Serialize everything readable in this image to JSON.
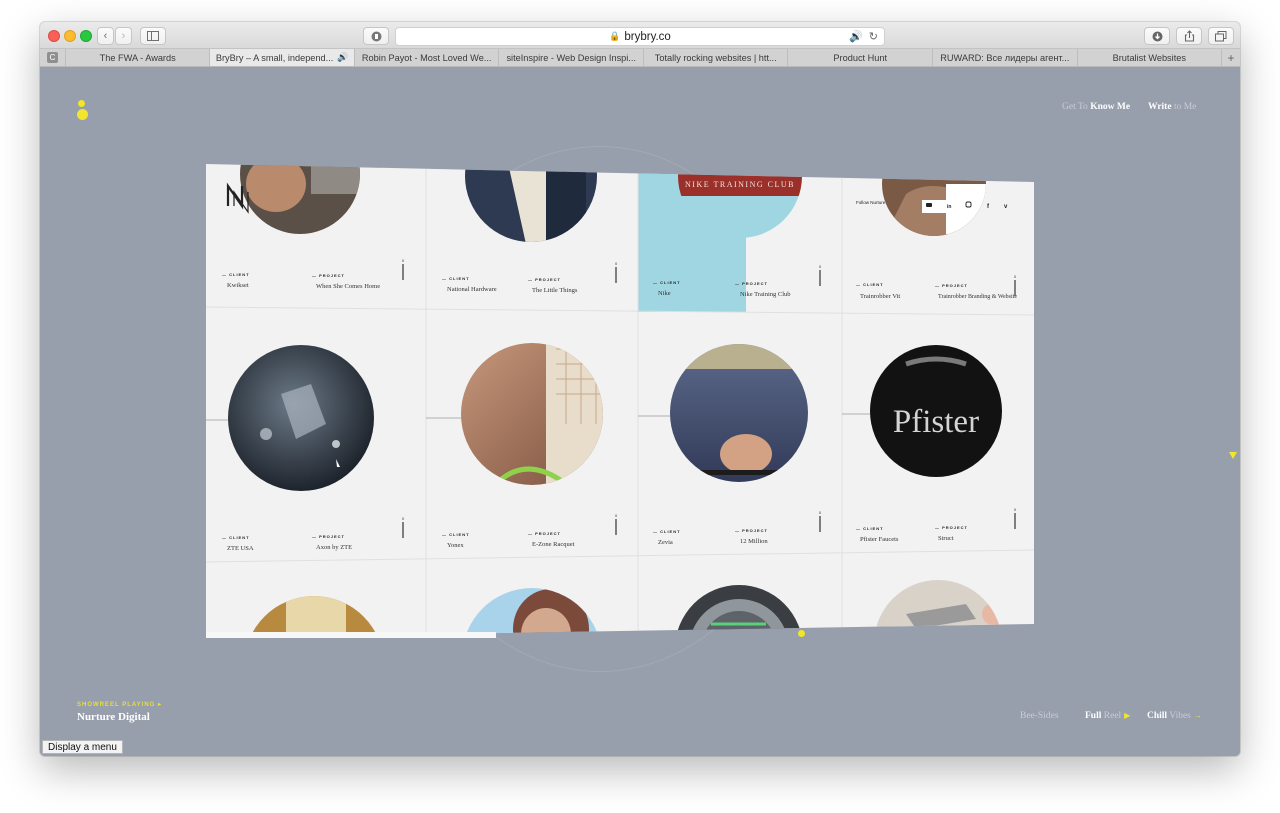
{
  "browser": {
    "url": "brybry.co",
    "tabs": [
      {
        "label": "The FWA - Awards",
        "active": false,
        "audio": false
      },
      {
        "label": "BryBry – A small, independ...",
        "active": true,
        "audio": true
      },
      {
        "label": "Robin Payot - Most Loved We...",
        "active": false,
        "audio": false
      },
      {
        "label": "siteInspire - Web Design Inspi...",
        "active": false,
        "audio": false
      },
      {
        "label": "Totally rocking websites | htt...",
        "active": false,
        "audio": false
      },
      {
        "label": "Product Hunt",
        "active": false,
        "audio": false
      },
      {
        "label": "RUWARD: Все лидеры агент...",
        "active": false,
        "audio": false
      },
      {
        "label": "Brutalist Websites",
        "active": false,
        "audio": false
      }
    ],
    "tooltip": "Display a menu"
  },
  "nav": {
    "get_prefix": "Get To",
    "get_bold": "Know Me",
    "write_bold": "Write",
    "write_suffix": "to Me"
  },
  "showreel": {
    "label": "SHOWREEL PLAYING",
    "title": "Nurture Digital"
  },
  "reels": {
    "bee_sides": "Bee-Sides",
    "full_bold": "Full",
    "full_suffix": "Reel",
    "chill_bold": "Chill",
    "chill_suffix": "Vibes"
  },
  "projects_grid": {
    "labels": {
      "client": "— CLIENT",
      "project": "— PROJECT",
      "follow": "Follow Nurture"
    },
    "rows": [
      [
        {
          "client": "Kwikset",
          "project": "When She Comes Home",
          "num": "0"
        },
        {
          "client": "National Hardware",
          "project": "The Little Things",
          "num": "0"
        },
        {
          "client": "Nike",
          "project": "Nike Training Club",
          "num": "0",
          "banner": "NIKE TRAINING CLUB"
        },
        {
          "client": "Trainrobber Vit",
          "project": "Trainrobber Branding & Website",
          "num": "0"
        }
      ],
      [
        {
          "client": "ZTE USA",
          "project": "Axon by ZTE",
          "num": "0"
        },
        {
          "client": "Yonex",
          "project": "E-Zone Racquet",
          "num": "0"
        },
        {
          "client": "Zevia",
          "project": "12 Million",
          "num": "0"
        },
        {
          "client": "Pfister Faucets",
          "project": "Struct",
          "num": "0",
          "overlay": "Pfister"
        }
      ]
    ]
  },
  "colors": {
    "page_bg": "#979eac",
    "accent_yellow": "#f1e62b",
    "grid_bg": "#f2f2f2",
    "nike_blue": "#9fd6e2"
  }
}
